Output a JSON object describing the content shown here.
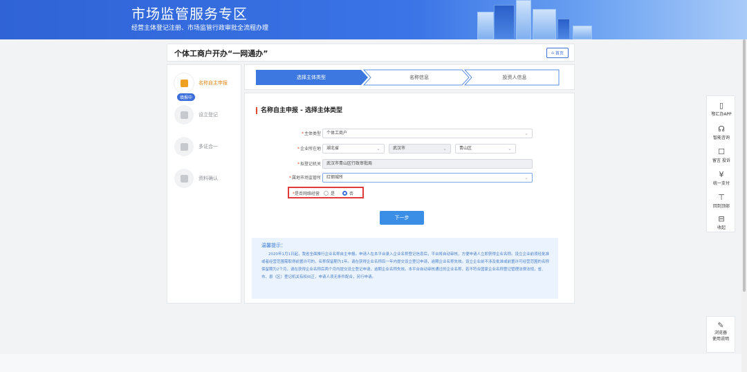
{
  "banner": {
    "title": "市场监管服务专区",
    "subtitle": "经营主体登记注册、市场监管行政审批全流程办理"
  },
  "page": {
    "title": "个体工商户开办“一网通办”",
    "home_label": "首页"
  },
  "steps": {
    "items": [
      {
        "label": "名称自主申报",
        "active": true,
        "icon": "edit-icon"
      },
      {
        "label": "设立登记",
        "active": false,
        "icon": "form-icon"
      },
      {
        "label": "多证合一",
        "active": false,
        "icon": "certificate-icon"
      },
      {
        "label": "资料确认",
        "active": false,
        "icon": "document-icon"
      }
    ],
    "status_badge": "填报中"
  },
  "progress": {
    "items": [
      {
        "label": "选择主体类型",
        "active": true
      },
      {
        "label": "名称信息",
        "active": false
      },
      {
        "label": "投资人信息",
        "active": false
      }
    ]
  },
  "form": {
    "section_title": "名称自主申报 - 选择主体类型",
    "entity_type": {
      "label": "主体类型",
      "value": "个体工商户"
    },
    "location": {
      "label": "企业所在地",
      "province": "湖北省",
      "city": "武汉市",
      "district": "青山区"
    },
    "registration_authority": {
      "label": "拟登记机关",
      "value": "武汉市青山区行政审批局"
    },
    "supervision_office": {
      "label": "属地市场监管所",
      "value": "红钢城所"
    },
    "online_business": {
      "label": "是否网络经营",
      "options": [
        "是",
        "否"
      ],
      "selected": "否"
    },
    "next_label": "下一步"
  },
  "notice": {
    "heading": "温馨提示：",
    "body": "2020年1月1日起，我省全面推行企业名称自主申报。申请人在本平台录入企业名称登记信息后，平台将自动审核，方便申请人立即获得企业名称。设立企业前须经批准或者经营范围需取得前置许可的，名称保留期为1年。请在获得企业名称后一年内提交设立登记申请，逾期企业名称失效。设立企业前不涉及批准或前置许可经营范围的名称保留期为2个月，请在获得企业名称后两个月内提交设立登记申请，逾期企业名称失效。本平台自动审核通过的企业名称，若不符合国家企业名称登记管理法律法规，省、市、县（区）登记机关有权纠正，申请人须无条件配合，另行申请。"
  },
  "toolbar": {
    "items": [
      {
        "label": "鄂汇办APP",
        "icon": "mobile-icon"
      },
      {
        "label": "智能咨询",
        "icon": "headset-icon"
      },
      {
        "label": "留言 投诉",
        "icon": "message-icon"
      },
      {
        "label": "统一支付",
        "icon": "payment-icon"
      },
      {
        "label": "回到顶部",
        "icon": "back-to-top-icon"
      },
      {
        "label": "收起",
        "icon": "collapse-icon"
      }
    ],
    "browser_help": "浏览器\n使用说明"
  },
  "colors": {
    "brand": "#2f63d6",
    "accent_orange": "#e0861a",
    "highlight_red": "#e03a3a",
    "button_blue": "#3a8ee6"
  }
}
